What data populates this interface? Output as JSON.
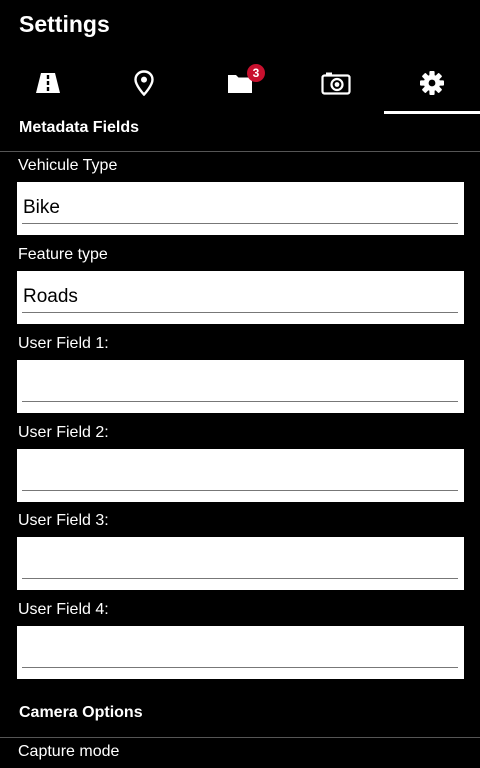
{
  "appbar": {
    "title": "Settings"
  },
  "tabs": [
    {
      "name": "road",
      "icon": "road-icon",
      "active": false
    },
    {
      "name": "location",
      "icon": "map-pin-icon",
      "active": false
    },
    {
      "name": "folder",
      "icon": "folder-icon",
      "badge": "3",
      "active": false
    },
    {
      "name": "camera",
      "icon": "camera-icon",
      "active": false
    },
    {
      "name": "settings",
      "icon": "gear-icon",
      "active": true
    }
  ],
  "colors": {
    "background": "#000000",
    "badge": "#c8102e",
    "field_bg": "#ffffff"
  },
  "metadata": {
    "header": "Metadata Fields",
    "fields": [
      {
        "label": "Vehicule Type",
        "value": "Bike"
      },
      {
        "label": "Feature type",
        "value": "Roads"
      },
      {
        "label": "User Field 1:",
        "value": ""
      },
      {
        "label": "User Field 2:",
        "value": ""
      },
      {
        "label": "User Field 3:",
        "value": ""
      },
      {
        "label": "User Field 4:",
        "value": ""
      }
    ]
  },
  "camera": {
    "header": "Camera Options",
    "capture_mode_label": "Capture mode"
  }
}
